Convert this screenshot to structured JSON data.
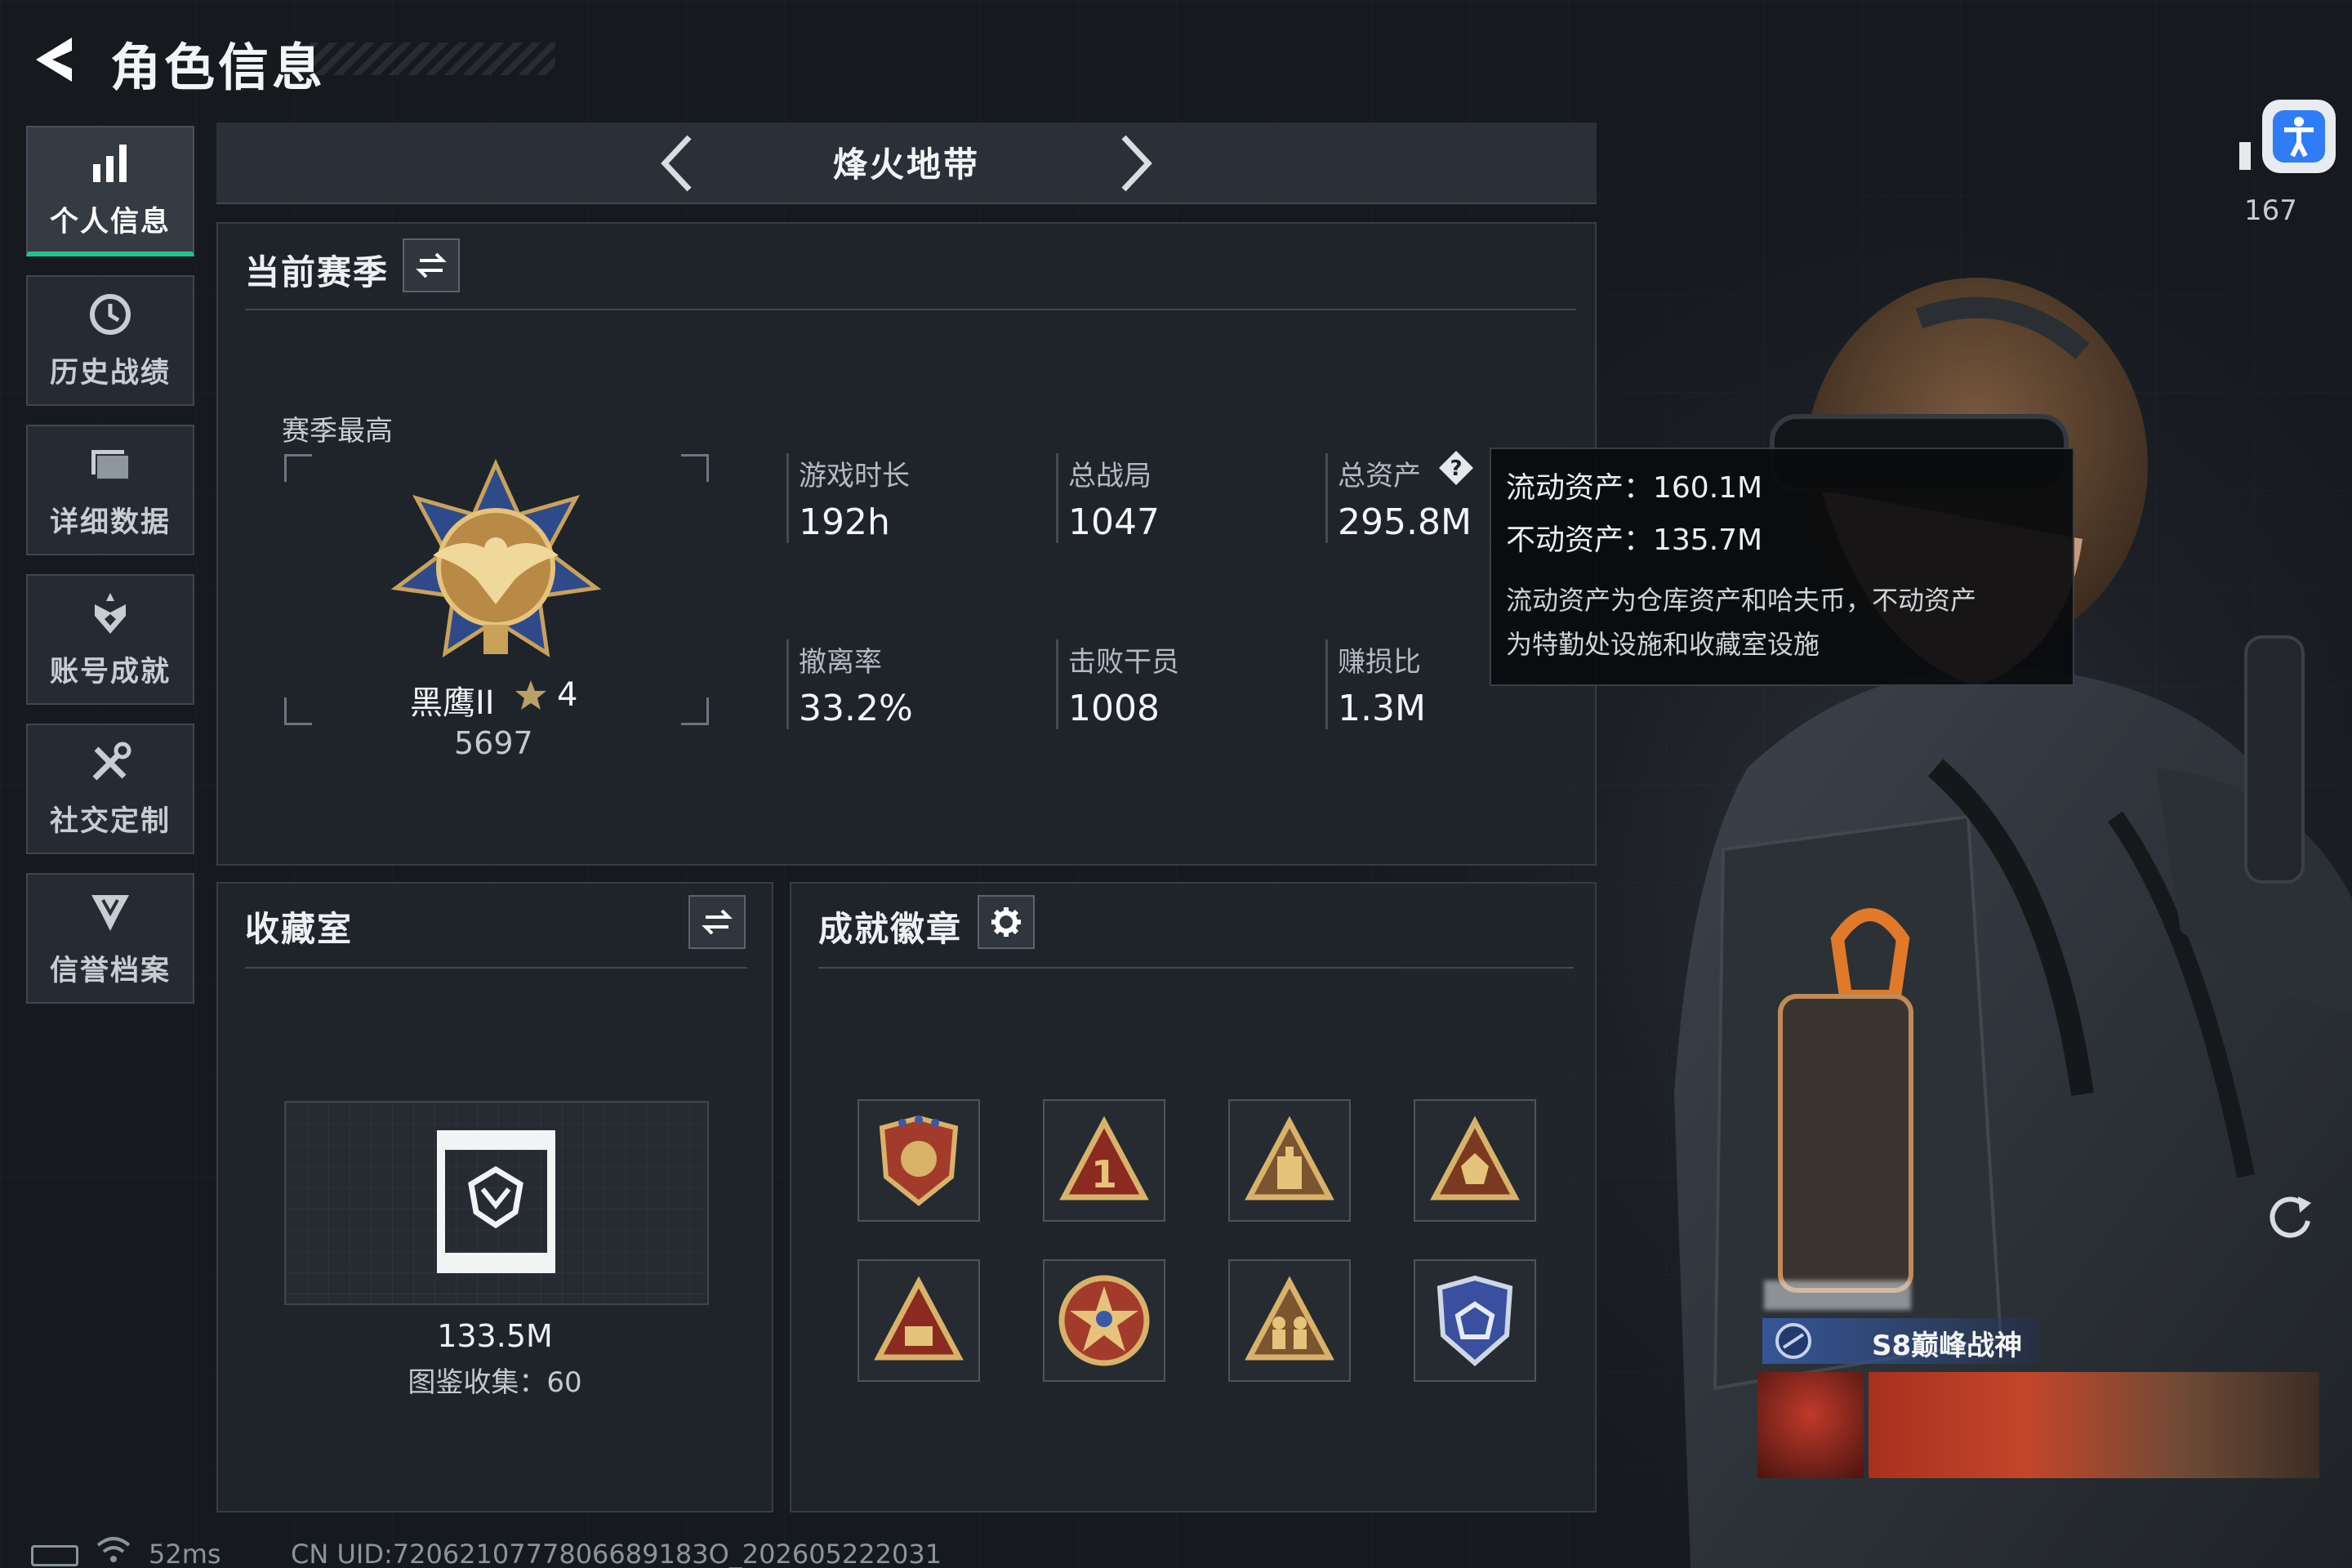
{
  "header": {
    "title": "角色信息"
  },
  "sidebar": {
    "items": [
      {
        "label": "个人信息",
        "icon": "bar-chart-icon",
        "active": true
      },
      {
        "label": "历史战绩",
        "icon": "history-clock-icon",
        "active": false
      },
      {
        "label": "详细数据",
        "icon": "folder-icon",
        "active": false
      },
      {
        "label": "账号成就",
        "icon": "achievement-icon",
        "active": false
      },
      {
        "label": "社交定制",
        "icon": "tools-icon",
        "active": false
      },
      {
        "label": "信誉档案",
        "icon": "shield-credit-icon",
        "active": false
      }
    ]
  },
  "map_nav": {
    "title": "烽火地带"
  },
  "season": {
    "title": "当前赛季",
    "best_label": "赛季最高",
    "rank_name": "黑鹰II",
    "rank_stars": "4",
    "rank_score": "5697",
    "stats": [
      {
        "label": "游戏时长",
        "value": "192h"
      },
      {
        "label": "总战局",
        "value": "1047"
      },
      {
        "label": "总资产",
        "value": "295.8M"
      },
      {
        "label": "撤离率",
        "value": "33.2%"
      },
      {
        "label": "击败干员",
        "value": "1008"
      },
      {
        "label": "赚损比",
        "value": "1.3M"
      }
    ]
  },
  "tooltip": {
    "liquid": "流动资产：160.1M",
    "fixed": "不动资产：135.7M",
    "desc_line1": "流动资产为仓库资产和哈夫币，不动资产",
    "desc_line2": "为特勤处设施和收藏室设施"
  },
  "collection": {
    "title": "收藏室",
    "value": "133.5M",
    "count_text": "图鉴收集：60"
  },
  "badges": {
    "title": "成就徽章"
  },
  "profile": {
    "count": "167",
    "title_badge": "S8巅峰战神"
  },
  "status": {
    "ping": "52ms",
    "uid": "CN UID:7206210777806689183O_202605222031"
  },
  "colors": {
    "accent_green": "#27c087",
    "gold": "#c9a25a",
    "accessibility_blue": "#2f7cf6"
  }
}
